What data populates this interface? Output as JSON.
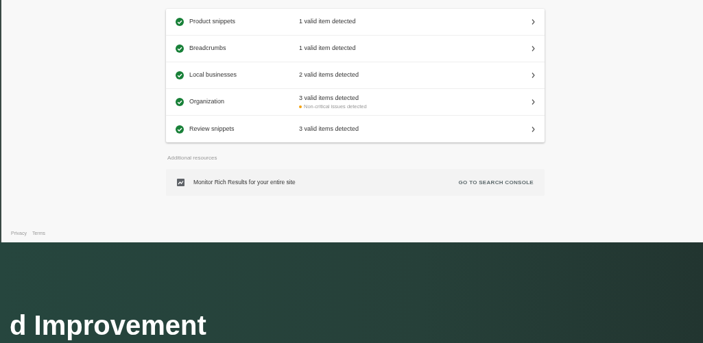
{
  "results": [
    {
      "name": "Product snippets",
      "valid": true,
      "detected": "1 valid item detected"
    },
    {
      "name": "Breadcrumbs",
      "valid": true,
      "detected": "1 valid item detected"
    },
    {
      "name": "Local businesses",
      "valid": true,
      "detected": "2 valid items detected"
    },
    {
      "name": "Organization",
      "valid": true,
      "detected": "3 valid items detected",
      "warning": "Non-critical issues detected"
    },
    {
      "name": "Review snippets",
      "valid": true,
      "detected": "3 valid items detected"
    }
  ],
  "resources": {
    "label": "Additional resources",
    "text": "Monitor Rich Results for your entire site",
    "action": "GO TO SEARCH CONSOLE"
  },
  "footer": {
    "links": [
      "Privacy",
      "Terms"
    ]
  },
  "banner": {
    "heading": "d Improvement"
  }
}
